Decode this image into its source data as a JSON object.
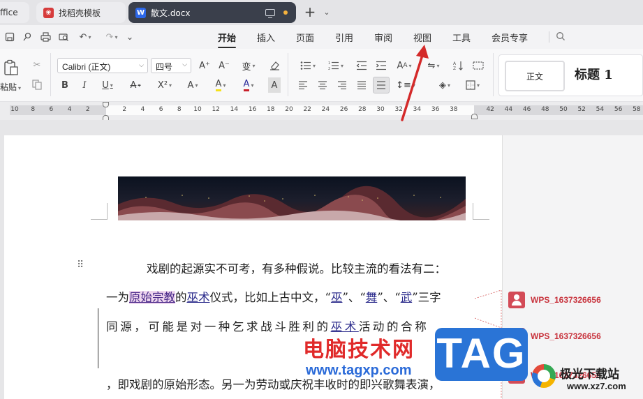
{
  "tabs": {
    "office_partial": "ffice",
    "template": "找稻壳模板",
    "document": "散文.docx",
    "template_icon_glyph": "W",
    "docx_icon_glyph": "W",
    "new_tab": "+"
  },
  "quick_access": {
    "icons": [
      "save-icon",
      "pin-icon",
      "print-icon",
      "print-preview-icon",
      "undo-icon",
      "redo-icon",
      "more-chevron-icon"
    ]
  },
  "menu": {
    "items": [
      "开始",
      "插入",
      "页面",
      "引用",
      "审阅",
      "视图",
      "工具",
      "会员专享"
    ],
    "active": "开始"
  },
  "ribbon": {
    "paste_label": "粘贴",
    "font_name": "Calibri (正文)",
    "font_size": "四号",
    "grow_font": "A⁺",
    "shrink_font": "A⁻",
    "phonetic": "变",
    "bold": "B",
    "italic": "I",
    "underline": "U",
    "strike": "A",
    "superscript": "X²",
    "text_effect": "A",
    "highlight": "A",
    "font_color": "A",
    "char_shading": "A",
    "styles": {
      "normal": "正文",
      "heading1": "标题 1"
    },
    "colors": {
      "highlight": "#f5e11a",
      "font_color": "#c8202a"
    }
  },
  "ruler": {
    "left_ticks": [
      "10",
      "8",
      "6",
      "4",
      "2"
    ],
    "right_ticks": [
      "2",
      "4",
      "6",
      "8",
      "10",
      "12",
      "14",
      "16",
      "18",
      "20",
      "22",
      "24",
      "26",
      "28",
      "30",
      "32",
      "34",
      "36",
      "38",
      "42",
      "44",
      "46",
      "48",
      "50",
      "52",
      "54",
      "56",
      "58"
    ]
  },
  "document": {
    "para1": "戏剧的起源实不可考，有多种假说。比较主流的看法有二：",
    "line2": {
      "a": "一为",
      "b": "原始宗教",
      "c": "的",
      "d": "巫术",
      "e": "仪式，比如上古中文，“",
      "f": "巫",
      "g": "”、“",
      "h": "舞",
      "i": "”、“",
      "j": "武",
      "k": "”三字"
    },
    "line3": {
      "a": "同源，可能是对一种乞求战斗胜利的",
      "b": "巫术",
      "c": "活动的合称"
    },
    "line4": "，即戏剧的原始形态。另一为劳动或庆祝丰收时的即兴歌舞表演，"
  },
  "comments": [
    {
      "author": "WPS_1637326656"
    },
    {
      "author": "WPS_1637326656"
    },
    {
      "author": "WPS_1637326656"
    }
  ],
  "watermarks": {
    "cn": "电脑技术网",
    "url": "www.tagxp.com",
    "tag": "TAG",
    "site_name": "极光下载站",
    "site_url": "www.xz7.com"
  },
  "accent_colors": {
    "active_tab_bg": "#3a3f4b",
    "comment_red": "#c8323c",
    "annotation_arrow": "#d42a2a"
  }
}
